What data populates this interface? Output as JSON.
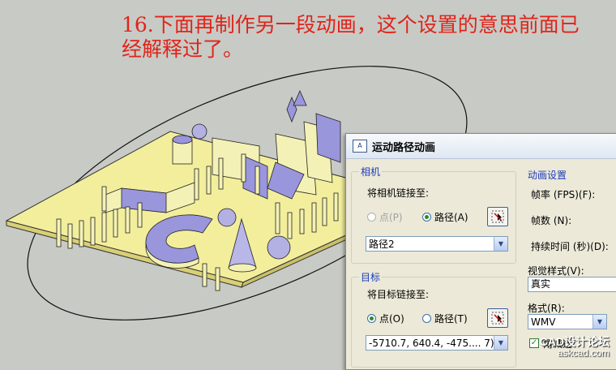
{
  "caption": {
    "line1": "16.下面再制作另一段动画，这个设置的意思前面已",
    "line2": "经解释过了。"
  },
  "dialog": {
    "title": "运动路径动画",
    "camera": {
      "group_label": "相机",
      "link_label": "将相机链接至:",
      "point_label": "点(P)",
      "path_label": "路径(A)",
      "selected": "path",
      "path_value": "路径2"
    },
    "target": {
      "group_label": "目标",
      "link_label": "将目标链接至:",
      "point_label": "点(O)",
      "path_label": "路径(T)",
      "selected": "point",
      "point_value": "-5710.7, 640.4, -475....  7)"
    },
    "animation": {
      "group_label": "动画设置",
      "fps_label": "帧率 (FPS)(F):",
      "frames_label": "帧数 (N):",
      "duration_label": "持续时间 (秒)(D):",
      "visual_style_label": "视觉样式(V):",
      "visual_style_value": "真实",
      "format_label": "格式(R):",
      "format_value": "WMV",
      "corner_check_label": "角减速"
    }
  },
  "watermark": {
    "line1": "CAD设计论坛",
    "line2": "askcad.com"
  },
  "colors": {
    "caption": "#e0241b",
    "group_label": "#1d3cbd",
    "base_plate": "#f2ee9c",
    "object_fill": "#9a96dc",
    "object_light": "#f4f1b6"
  }
}
